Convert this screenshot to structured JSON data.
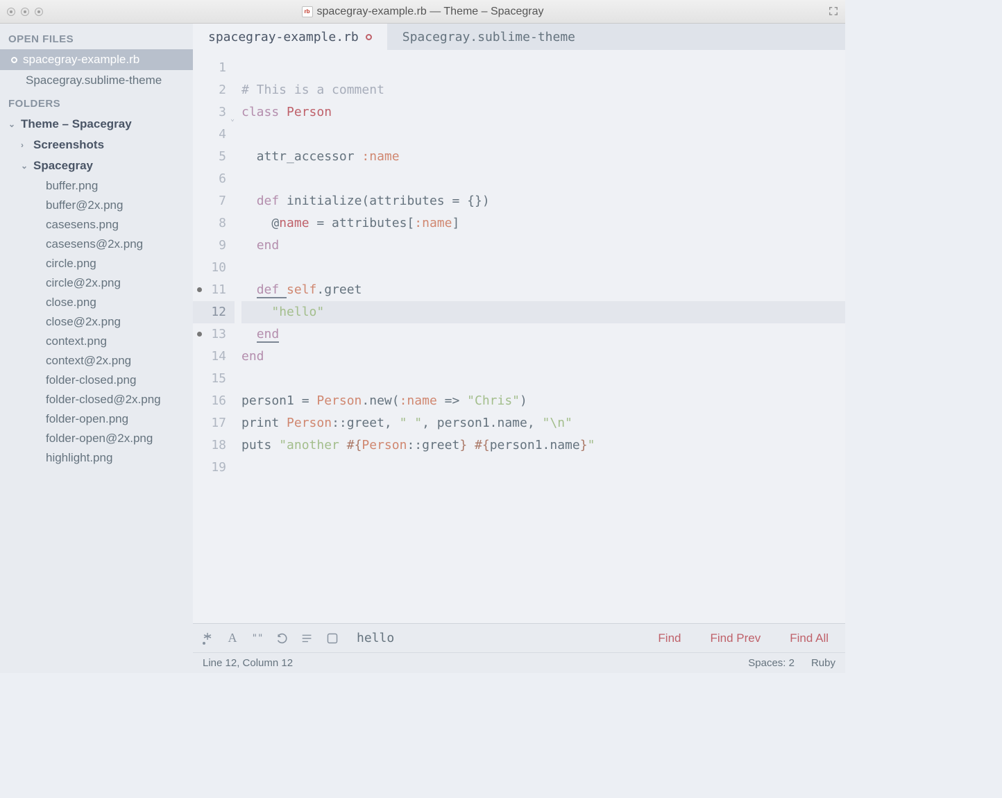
{
  "window": {
    "title": "spacegray-example.rb — Theme – Spacegray"
  },
  "sidebar": {
    "open_files_header": "OPEN FILES",
    "folders_header": "FOLDERS",
    "open_files": [
      {
        "name": "spacegray-example.rb",
        "dirty": true,
        "selected": true
      },
      {
        "name": "Spacegray.sublime-theme",
        "dirty": false,
        "selected": false
      }
    ],
    "root_folder": "Theme – Spacegray",
    "subfolders": [
      {
        "name": "Screenshots",
        "expanded": false
      },
      {
        "name": "Spacegray",
        "expanded": true
      }
    ],
    "files": [
      "buffer.png",
      "buffer@2x.png",
      "casesens.png",
      "casesens@2x.png",
      "circle.png",
      "circle@2x.png",
      "close.png",
      "close@2x.png",
      "context.png",
      "context@2x.png",
      "folder-closed.png",
      "folder-closed@2x.png",
      "folder-open.png",
      "folder-open@2x.png",
      "highlight.png"
    ]
  },
  "tabs": [
    {
      "label": "spacegray-example.rb",
      "dirty": true,
      "active": true
    },
    {
      "label": "Spacegray.sublime-theme",
      "dirty": false,
      "active": false
    }
  ],
  "code": {
    "highlighted_line": 12,
    "marks": [
      11,
      13
    ],
    "fold_lines": [
      3
    ],
    "lines": [
      {
        "n": 1,
        "t": [
          {
            "c": "",
            "k": ""
          }
        ]
      },
      {
        "n": 2,
        "t": [
          {
            "c": "# This is a comment",
            "k": "comment"
          }
        ]
      },
      {
        "n": 3,
        "t": [
          {
            "c": "class ",
            "k": "kw"
          },
          {
            "c": "Person",
            "k": "class"
          }
        ]
      },
      {
        "n": 4,
        "t": [
          {
            "c": "",
            "k": ""
          }
        ]
      },
      {
        "n": 5,
        "t": [
          {
            "c": "  attr_accessor ",
            "k": "def"
          },
          {
            "c": ":name",
            "k": "sym"
          }
        ]
      },
      {
        "n": 6,
        "t": [
          {
            "c": "",
            "k": ""
          }
        ]
      },
      {
        "n": 7,
        "t": [
          {
            "c": "  ",
            "k": ""
          },
          {
            "c": "def ",
            "k": "kw"
          },
          {
            "c": "initialize",
            "k": "fn"
          },
          {
            "c": "(attributes = {})",
            "k": "punc"
          }
        ]
      },
      {
        "n": 8,
        "t": [
          {
            "c": "    @",
            "k": "punc"
          },
          {
            "c": "name",
            "k": "var"
          },
          {
            "c": " = attributes[",
            "k": "punc"
          },
          {
            "c": ":name",
            "k": "sym"
          },
          {
            "c": "]",
            "k": "punc"
          }
        ]
      },
      {
        "n": 9,
        "t": [
          {
            "c": "  ",
            "k": ""
          },
          {
            "c": "end",
            "k": "kw"
          }
        ]
      },
      {
        "n": 10,
        "t": [
          {
            "c": "",
            "k": ""
          }
        ]
      },
      {
        "n": 11,
        "t": [
          {
            "c": "  ",
            "k": ""
          },
          {
            "c": "def ",
            "k": "kw",
            "u": true
          },
          {
            "c": "self",
            "k": "const"
          },
          {
            "c": ".greet",
            "k": "fn"
          }
        ]
      },
      {
        "n": 12,
        "t": [
          {
            "c": "    ",
            "k": ""
          },
          {
            "c": "\"hello\"",
            "k": "str"
          }
        ]
      },
      {
        "n": 13,
        "t": [
          {
            "c": "  ",
            "k": ""
          },
          {
            "c": "end",
            "k": "kw",
            "u": true
          }
        ]
      },
      {
        "n": 14,
        "t": [
          {
            "c": "end",
            "k": "kw"
          }
        ]
      },
      {
        "n": 15,
        "t": [
          {
            "c": "",
            "k": ""
          }
        ]
      },
      {
        "n": 16,
        "t": [
          {
            "c": "person1 = ",
            "k": "punc"
          },
          {
            "c": "Person",
            "k": "const"
          },
          {
            "c": ".new(",
            "k": "punc"
          },
          {
            "c": ":name",
            "k": "sym"
          },
          {
            "c": " => ",
            "k": "punc"
          },
          {
            "c": "\"Chris\"",
            "k": "str"
          },
          {
            "c": ")",
            "k": "punc"
          }
        ]
      },
      {
        "n": 17,
        "t": [
          {
            "c": "print ",
            "k": "punc"
          },
          {
            "c": "Person",
            "k": "const"
          },
          {
            "c": "::greet, ",
            "k": "punc"
          },
          {
            "c": "\" \"",
            "k": "str"
          },
          {
            "c": ", person1.name, ",
            "k": "punc"
          },
          {
            "c": "\"\\n\"",
            "k": "str"
          }
        ]
      },
      {
        "n": 18,
        "t": [
          {
            "c": "puts ",
            "k": "punc"
          },
          {
            "c": "\"another ",
            "k": "str"
          },
          {
            "c": "#{",
            "k": "interp"
          },
          {
            "c": "Person",
            "k": "const"
          },
          {
            "c": "::greet",
            "k": "punc"
          },
          {
            "c": "}",
            "k": "interp"
          },
          {
            "c": " ",
            "k": "str"
          },
          {
            "c": "#{",
            "k": "interp"
          },
          {
            "c": "person1.name",
            "k": "punc"
          },
          {
            "c": "}",
            "k": "interp"
          },
          {
            "c": "\"",
            "k": "str"
          }
        ]
      },
      {
        "n": 19,
        "t": [
          {
            "c": "",
            "k": ""
          }
        ]
      }
    ]
  },
  "findbar": {
    "query": "hello",
    "find": "Find",
    "find_prev": "Find Prev",
    "find_all": "Find All"
  },
  "status": {
    "position": "Line 12, Column 12",
    "spaces": "Spaces: 2",
    "syntax": "Ruby"
  }
}
